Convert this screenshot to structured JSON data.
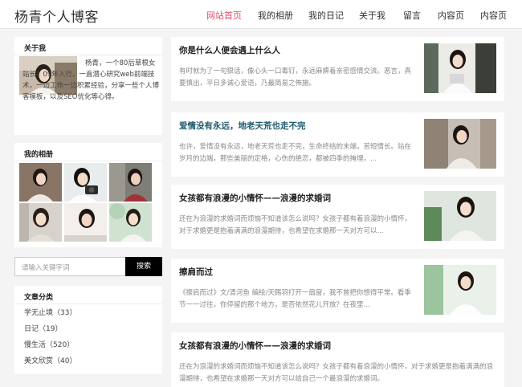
{
  "header": {
    "logo": "杨青个人博客",
    "nav": [
      {
        "label": "网站首页",
        "active": true
      },
      {
        "label": "我的相册",
        "active": false
      },
      {
        "label": "我的日记",
        "active": false
      },
      {
        "label": "关于我",
        "active": false
      },
      {
        "label": "留言",
        "active": false
      },
      {
        "label": "内容页",
        "active": false
      },
      {
        "label": "内容页",
        "active": false
      }
    ]
  },
  "sidebar": {
    "about": {
      "title": "关于我",
      "text": "杨青，一个80后草根女站长！09年入行。一直潜心研究web前端技术，一边工作一边积累经验，分享一些个人博客模板，以及SEO优化等心得。"
    },
    "album": {
      "title": "我的相册"
    },
    "search": {
      "placeholder": "请输入关键字词",
      "button": "搜索"
    },
    "categories": {
      "title": "文章分类",
      "items": [
        {
          "name": "学无止境",
          "count": "（33）"
        },
        {
          "name": "日记",
          "count": "（19）"
        },
        {
          "name": "慢生活",
          "count": "（520）"
        },
        {
          "name": "美文欣赏",
          "count": "（40）"
        }
      ]
    }
  },
  "articles": [
    {
      "title": "你是什么人便会遇上什么人",
      "desc": "有时就为了一句狠话，像心头一口毒钉，永远麻痹着亲密感情交流。恶言，真要慎出，平日多诚心爱语，乃最简易之佈施。"
    },
    {
      "title": "爱情没有永远，地老天荒也走不完",
      "desc": "也许，爱情没有永远，地老天荒也走不完，生命终结的末端，苦短情长。站在岁月的边端，那些美丽的定格，心伤的绝恋，都被四季的掩埋，..."
    },
    {
      "title": "女孩都有浪漫的小情怀——浪漫的求婚词",
      "desc": "还在为浪漫的求婚词而烦恼不知道该怎么说吗？女孩子都有着浪漫的小情怀，对于求婚更是抱着满满的浪漫期待，也希望在求婚那一天对方可以..."
    },
    {
      "title": "擦肩而过",
      "desc": "《擦肩而过》文/清河鱼 编绘/天赐羽打开一扇窗，我不曾把你想得平常。看季节一一过往。你停留的那个地方，是否依然花儿开放？在夜里..."
    },
    {
      "title": "女孩都有浪漫的小情怀——浪漫的求婚词",
      "desc": "还在为浪漫的求婚词而烦恼不知道该怎么说吗？女孩子都有着浪漫的小情怀，对于求婚更是抱着满满的浪漫期待，也希望在求婚那一天对方可以给自己一个最浪漫的求婚词。"
    }
  ]
}
